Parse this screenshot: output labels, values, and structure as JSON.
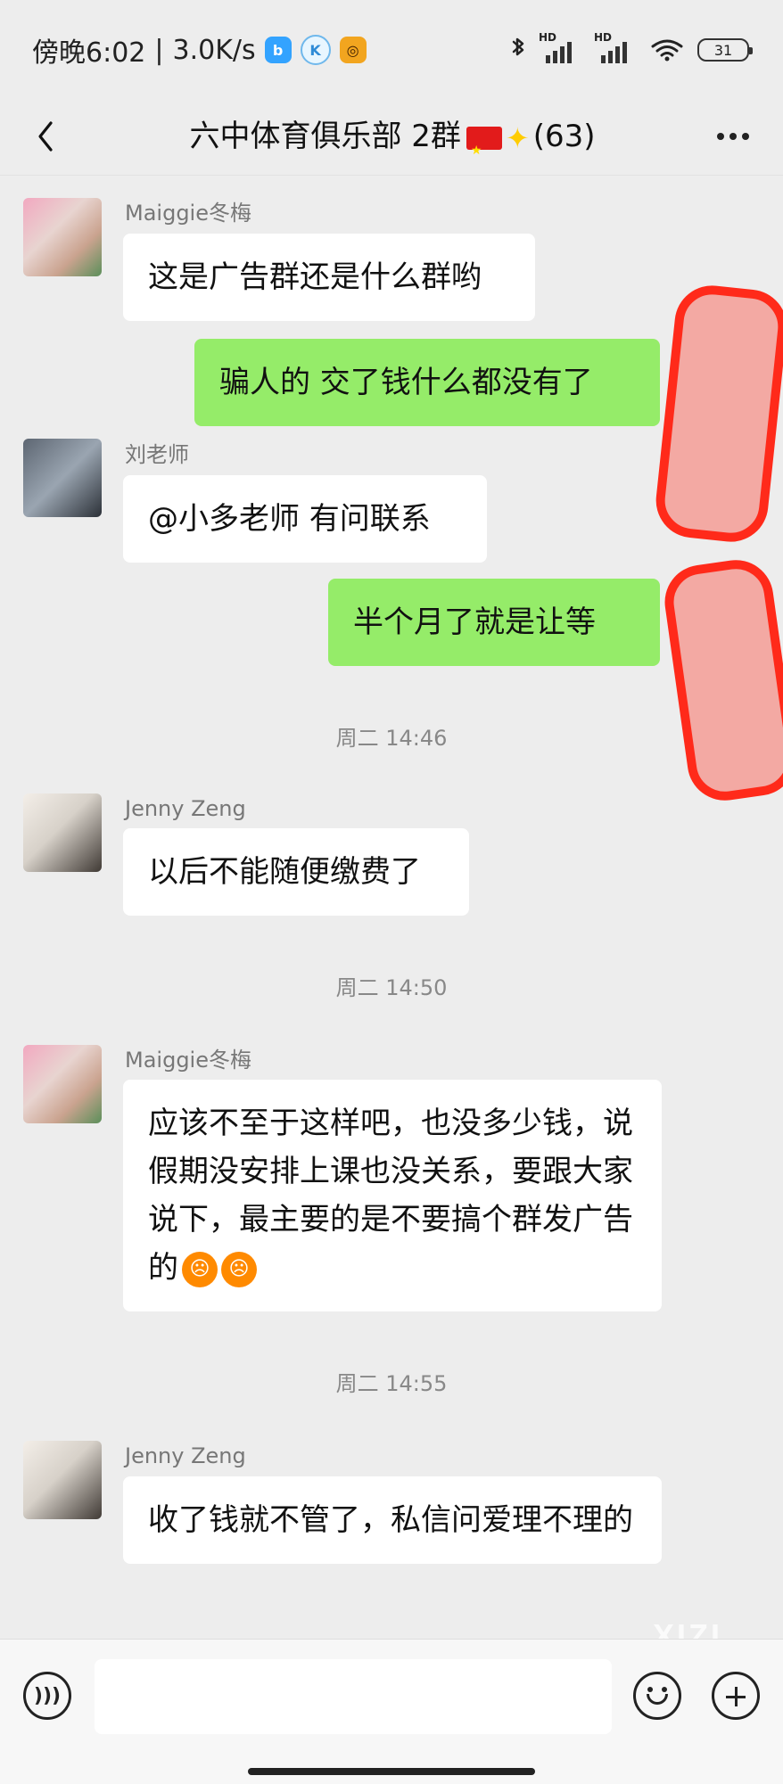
{
  "status_bar": {
    "time": "傍晚6:02",
    "speed": "3.0K/s",
    "battery": "31",
    "icons": [
      "bilibili-icon",
      "k-icon",
      "game-icon",
      "bluetooth-icon",
      "signal-icon",
      "wifi-icon",
      "battery-icon"
    ]
  },
  "header": {
    "title_prefix": "六中体育俱乐部 2群",
    "member_count": "(63)",
    "back_icon": "chevron-left-icon",
    "more_icon": "more-icon"
  },
  "messages": [
    {
      "sender": "Maiggie冬梅",
      "text": "这是广告群还是什么群哟"
    },
    {
      "sender": "me",
      "text": "骗人的  交了钱什么都没有了"
    },
    {
      "sender": "刘老师",
      "text": "@小多老师  有问联系"
    },
    {
      "sender": "me",
      "text": "半个月了就是让等"
    },
    {
      "timestamp": "周二 14:46"
    },
    {
      "sender": "Jenny Zeng",
      "text": "以后不能随便缴费了"
    },
    {
      "timestamp": "周二 14:50"
    },
    {
      "sender": "Maiggie冬梅",
      "text": "应该不至于这样吧，也没多少钱，说假期没安排上课也没关系，要跟大家说下，最主要的是不要搞个群发广告的"
    },
    {
      "timestamp": "周二 14:55"
    },
    {
      "sender": "Jenny Zeng",
      "text": "收了钱就不管了，私信问爱理不理的"
    }
  ],
  "input": {
    "placeholder": ""
  },
  "watermark": "XIZI",
  "colors": {
    "background": "#ededed",
    "sent_bubble": "#95ec69",
    "received_bubble": "#ffffff",
    "redaction": "#ff2a1a"
  }
}
